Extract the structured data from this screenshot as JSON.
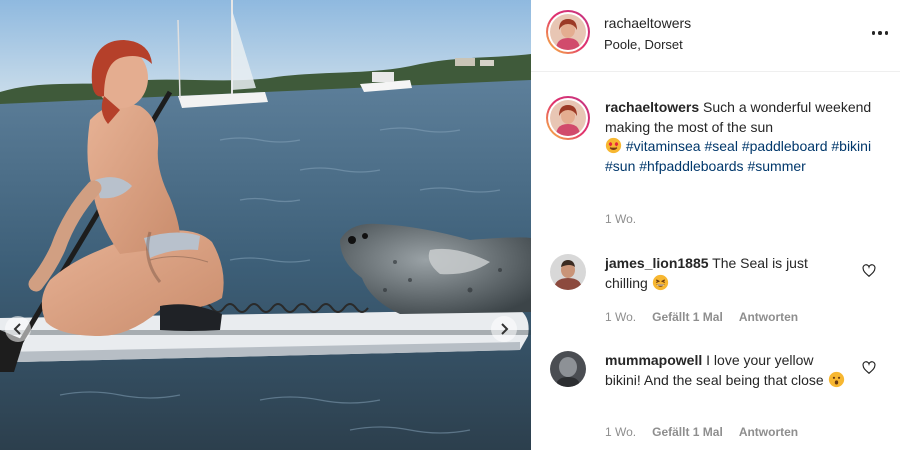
{
  "post": {
    "username": "rachaeltowers",
    "location": "Poole, Dorset",
    "more_icon": "more-horizontal-icon"
  },
  "caption": {
    "username": "rachaeltowers",
    "text": " Such a wonderful weekend making the most of the sun ",
    "emoji": "smiling-face-with-heart-eyes",
    "hashtags": [
      "#vitaminsea",
      "#seal",
      "#paddleboard",
      "#bikini",
      "#sun",
      "#hfpaddleboards",
      "#summer"
    ],
    "time": "1 Wo."
  },
  "comments": [
    {
      "username": "james_lion1885",
      "text": " The Seal is just chilling ",
      "emoji": "grinning-squinting-face",
      "time": "1 Wo.",
      "likes": "Gefällt 1 Mal",
      "reply": "Antworten"
    },
    {
      "username": "mummapowell",
      "text": " I love your yellow bikini! And the seal being that close ",
      "emoji": "hushed-face",
      "time": "1 Wo.",
      "likes": "Gefällt 1 Mal",
      "reply": "Antworten"
    }
  ],
  "colors": {
    "hashtag": "#00376b",
    "meta": "#8e8e8e",
    "text": "#262626"
  }
}
